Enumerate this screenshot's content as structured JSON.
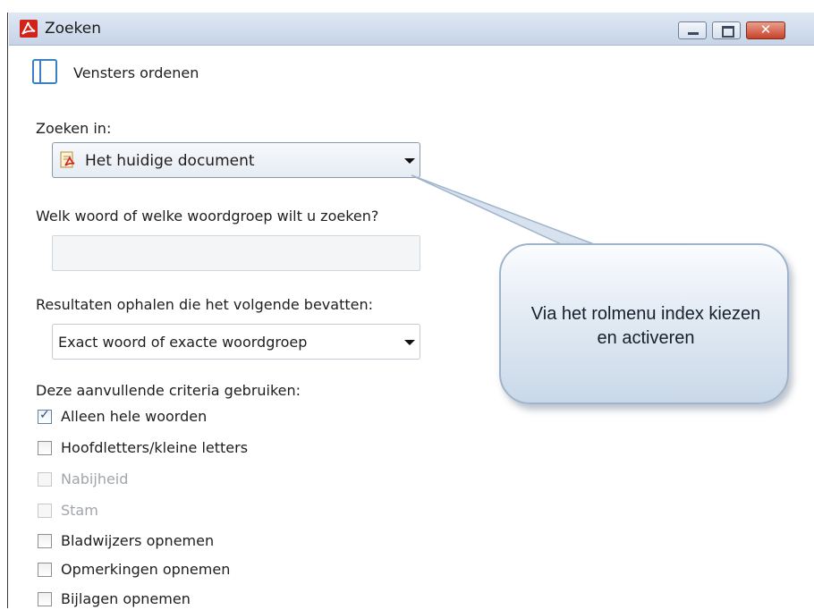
{
  "window": {
    "title": "Zoeken",
    "close_symbol": "✕"
  },
  "arrange_windows_label": "Vensters ordenen",
  "search_in": {
    "label": "Zoeken in:",
    "selected": "Het huidige document"
  },
  "query": {
    "label": "Welk woord of welke woordgroep wilt u zoeken?",
    "value": ""
  },
  "results": {
    "label": "Resultaten ophalen die het volgende bevatten:",
    "selected": "Exact woord of exacte woordgroep"
  },
  "criteria": {
    "label": "Deze aanvullende criteria gebruiken:",
    "items": [
      {
        "label": "Alleen hele woorden",
        "checked": true,
        "enabled": true
      },
      {
        "label": "Hoofdletters/kleine letters",
        "checked": false,
        "enabled": true
      },
      {
        "label": "Nabijheid",
        "checked": false,
        "enabled": false
      },
      {
        "label": "Stam",
        "checked": false,
        "enabled": false
      },
      {
        "label": "Bladwijzers opnemen",
        "checked": false,
        "enabled": true
      },
      {
        "label": "Opmerkingen opnemen",
        "checked": false,
        "enabled": true
      },
      {
        "label": "Bijlagen opnemen",
        "checked": false,
        "enabled": true
      }
    ]
  },
  "callout": {
    "text": "Via het rolmenu index kiezen en activeren"
  },
  "icons": {
    "app": "adobe-reader-icon",
    "arrange": "arrange-windows-icon",
    "document": "pdf-document-icon",
    "dropdown": "dropdown-caret-icon"
  },
  "colors": {
    "titlebar": "#c6d4e7",
    "close_button": "#c7412a",
    "app_icon": "#d1231a",
    "callout_fill": "#c9d8e8",
    "checkmark": "#1b4f8a",
    "disabled_text": "#a1a5aa"
  }
}
